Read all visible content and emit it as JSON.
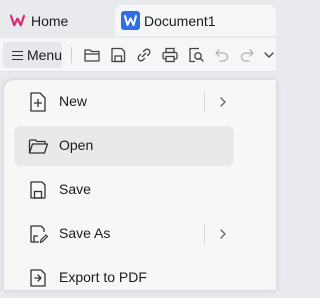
{
  "tabs": [
    {
      "label": "Home",
      "icon": "wps-logo-icon",
      "color": "#d62d73"
    },
    {
      "label": "Document1",
      "icon": "word-doc-icon",
      "color": "#2f6ee8"
    }
  ],
  "toolbar": {
    "menu_label": "Menu",
    "icons": [
      "new-file-icon",
      "save-icon",
      "share-icon",
      "print-icon",
      "print-preview-icon",
      "undo-icon",
      "redo-icon",
      "more-dropdown-icon"
    ]
  },
  "menu": {
    "items": [
      {
        "label": "New",
        "icon": "new-document-icon",
        "has_submenu": true
      },
      {
        "label": "Open",
        "icon": "folder-open-icon",
        "has_submenu": false,
        "highlighted": true
      },
      {
        "label": "Save",
        "icon": "save-icon",
        "has_submenu": false
      },
      {
        "label": "Save As",
        "icon": "save-as-icon",
        "has_submenu": true
      },
      {
        "label": "Export to PDF",
        "icon": "export-pdf-icon",
        "has_submenu": false
      }
    ]
  }
}
